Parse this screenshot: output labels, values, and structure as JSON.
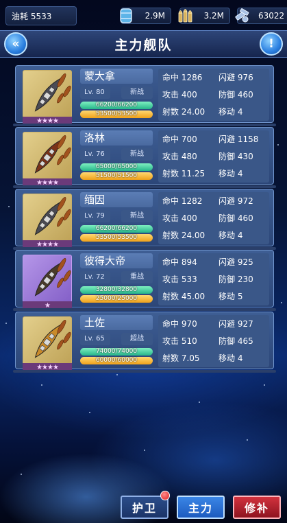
{
  "topbar": {
    "oil_label": "油耗 5533",
    "resources": [
      {
        "icon": "fuel-barrel-icon",
        "value": "2.9M"
      },
      {
        "icon": "ammo-icon",
        "value": "3.2M"
      },
      {
        "icon": "steel-parts-icon",
        "value": "63022"
      }
    ]
  },
  "header": {
    "title": "主力舰队",
    "back_icon": "double-chevron-left-icon",
    "info_icon": "exclamation-icon"
  },
  "ships": [
    {
      "name": "蒙大拿",
      "level": "Lv. 80",
      "tag": "新战",
      "hp": "66200/66200",
      "fuel": "53500/53500",
      "stars": "★★★★",
      "rarity": "gold",
      "hit": "命中 1286",
      "evade": "闪避 976",
      "atk": "攻击 400",
      "def": "防御 460",
      "range": "射数 24.00",
      "move": "移动 4"
    },
    {
      "name": "洛林",
      "level": "Lv. 76",
      "tag": "新战",
      "hp": "65000/65000",
      "fuel": "51500/51500",
      "stars": "★★★★",
      "rarity": "gold",
      "hit": "命中 700",
      "evade": "闪避 1158",
      "atk": "攻击 480",
      "def": "防御 430",
      "range": "射数 11.25",
      "move": "移动 4"
    },
    {
      "name": "缅因",
      "level": "Lv. 79",
      "tag": "新战",
      "hp": "66200/66200",
      "fuel": "53500/53500",
      "stars": "★★★★",
      "rarity": "gold",
      "hit": "命中 1282",
      "evade": "闪避 972",
      "atk": "攻击 400",
      "def": "防御 460",
      "range": "射数 24.00",
      "move": "移动 4"
    },
    {
      "name": "彼得大帝",
      "level": "Lv. 72",
      "tag": "重战",
      "hp": "32800/32800",
      "fuel": "25000/25000",
      "stars": "★",
      "rarity": "purple",
      "hit": "命中 894",
      "evade": "闪避 925",
      "atk": "攻击 533",
      "def": "防御 230",
      "range": "射数 45.00",
      "move": "移动 5"
    },
    {
      "name": "土佐",
      "level": "Lv. 65",
      "tag": "超战",
      "hp": "74000/74000",
      "fuel": "60000/60000",
      "stars": "★★★★",
      "rarity": "gold",
      "hit": "命中 970",
      "evade": "闪避 927",
      "atk": "攻击 510",
      "def": "防御 465",
      "range": "射数 7.05",
      "move": "移动 4"
    }
  ],
  "bottom": {
    "guard": "护卫",
    "main": "主力",
    "repair": "修补"
  },
  "colors": {
    "accent": "#2a7fe0",
    "hp_bar": "#26b58a",
    "fuel_bar": "#f0a21a",
    "repair_button": "#b01e2a"
  }
}
